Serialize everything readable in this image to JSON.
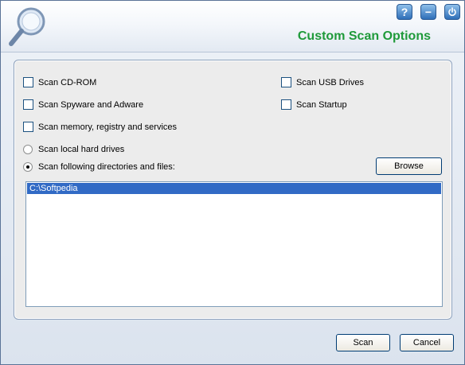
{
  "header": {
    "title": "Custom Scan Options",
    "help_label": "?",
    "minimize_label": "−",
    "close_icon": "power-icon"
  },
  "options": {
    "cdrom": "Scan CD-ROM",
    "usb": "Scan USB Drives",
    "spyware": "Scan Spyware and Adware",
    "startup": "Scan Startup",
    "memory": "Scan memory, registry and services"
  },
  "targets": {
    "local": "Scan local hard drives",
    "following": "Scan following directories and files:",
    "selected": "following"
  },
  "browse_label": "Browse",
  "paths": [
    "C:\\Softpedia"
  ],
  "footer": {
    "scan_label": "Scan",
    "cancel_label": "Cancel"
  },
  "colors": {
    "title": "#1f9a3a",
    "selection": "#316ac5"
  }
}
